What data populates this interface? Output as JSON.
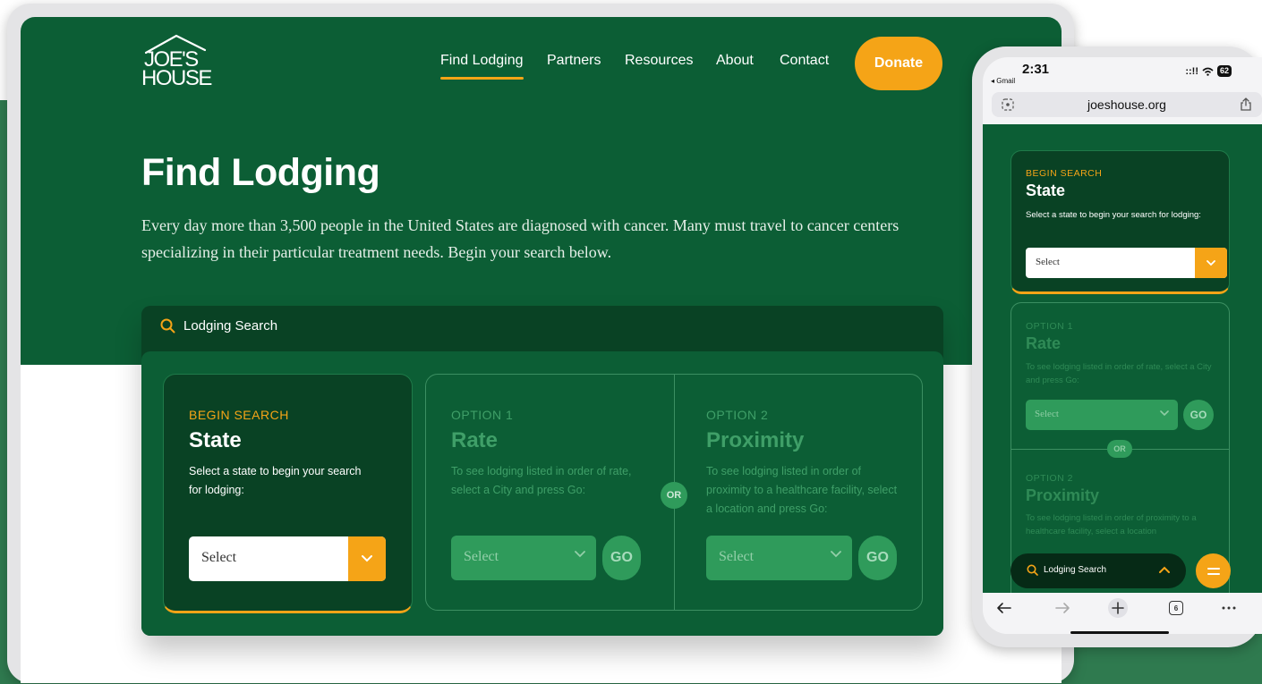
{
  "colors": {
    "brand_green": "#0c5e35",
    "dark_green": "#094224",
    "accent_orange": "#f5a417",
    "muted_green": "#2f9b5b"
  },
  "desktop": {
    "logo": {
      "line1": "JOE'S",
      "line2": "HOUSE"
    },
    "nav": [
      {
        "label": "Find Lodging",
        "active": true
      },
      {
        "label": "Partners"
      },
      {
        "label": "Resources"
      },
      {
        "label": "About"
      },
      {
        "label": "Contact"
      }
    ],
    "donate_label": "Donate",
    "page_title": "Find Lodging",
    "intro": "Every day more than 3,500 people in the United States are diagnosed with cancer. Many must travel to cancer centers specializing in their particular treatment needs. Begin your search below.",
    "search": {
      "title": "Lodging Search",
      "icon": "search-icon",
      "begin": {
        "eyebrow": "BEGIN SEARCH",
        "heading": "State",
        "description": "Select a state to begin your search for lodging:",
        "select_value": "Select"
      },
      "option1": {
        "eyebrow": "OPTION 1",
        "heading": "Rate",
        "description": "To see lodging listed in order of rate, select a City and press Go:",
        "select_value": "Select",
        "go_label": "GO"
      },
      "or_label": "OR",
      "option2": {
        "eyebrow": "OPTION 2",
        "heading": "Proximity",
        "description": "To see lodging listed in order of proximity to a healthcare facility, select a location and press Go:",
        "select_value": "Select",
        "go_label": "GO"
      }
    }
  },
  "phone": {
    "status": {
      "time": "2:31",
      "back_app": "◂ Gmail",
      "signal": "::!!",
      "battery": "62"
    },
    "url": "joeshouse.org",
    "begin": {
      "eyebrow": "BEGIN SEARCH",
      "heading": "State",
      "description": "Select a state to begin your search for lodging:",
      "select_value": "Select"
    },
    "option1": {
      "eyebrow": "OPTION 1",
      "heading": "Rate",
      "description": "To see lodging listed in order of rate, select a City and press Go:",
      "select_value": "Select",
      "go_label": "GO"
    },
    "or_label": "OR",
    "option2": {
      "eyebrow": "OPTION 2",
      "heading": "Proximity",
      "description": "To see lodging listed in order of proximity to a healthcare facility, select a location"
    },
    "search_bar_label": "Lodging Search",
    "tab_count": "6"
  }
}
